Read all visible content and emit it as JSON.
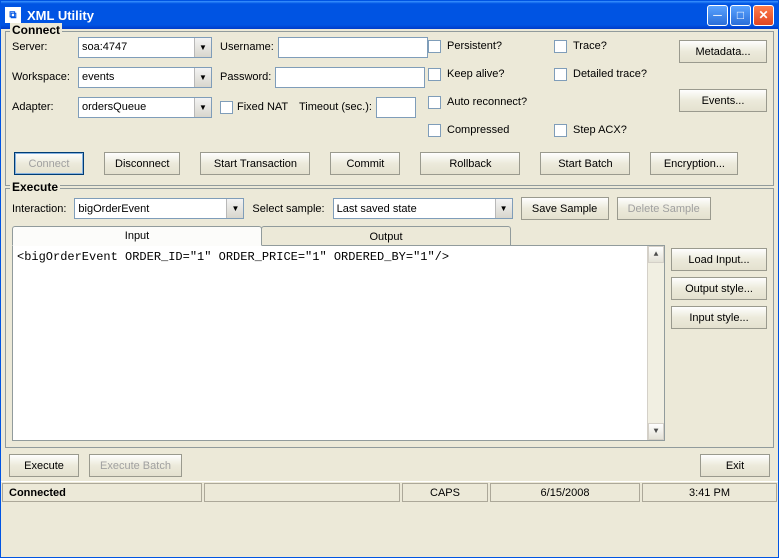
{
  "window": {
    "title": "XML Utility"
  },
  "connect": {
    "legend": "Connect",
    "server_label": "Server:",
    "server_value": "soa:4747",
    "workspace_label": "Workspace:",
    "workspace_value": "events",
    "adapter_label": "Adapter:",
    "adapter_value": "ordersQueue",
    "username_label": "Username:",
    "username_value": "",
    "password_label": "Password:",
    "password_value": "",
    "fixed_nat_label": "Fixed NAT",
    "timeout_label": "Timeout (sec.):",
    "timeout_value": "",
    "persistent_label": "Persistent?",
    "keepalive_label": "Keep alive?",
    "autoreconnect_label": "Auto reconnect?",
    "compressed_label": "Compressed",
    "trace_label": "Trace?",
    "detailed_trace_label": "Detailed trace?",
    "step_acx_label": "Step ACX?",
    "metadata_btn": "Metadata...",
    "events_btn": "Events...",
    "connect_btn": "Connect",
    "disconnect_btn": "Disconnect",
    "start_tx_btn": "Start Transaction",
    "commit_btn": "Commit",
    "rollback_btn": "Rollback",
    "start_batch_btn": "Start Batch",
    "encryption_btn": "Encryption..."
  },
  "execute": {
    "legend": "Execute",
    "interaction_label": "Interaction:",
    "interaction_value": "bigOrderEvent",
    "select_sample_label": "Select sample:",
    "select_sample_value": "Last saved state",
    "save_sample_btn": "Save Sample",
    "delete_sample_btn": "Delete Sample",
    "tab_input": "Input",
    "tab_output": "Output",
    "editor_text": "<bigOrderEvent ORDER_ID=\"1\" ORDER_PRICE=\"1\" ORDERED_BY=\"1\"/>",
    "load_input_btn": "Load Input...",
    "output_style_btn": "Output style...",
    "input_style_btn": "Input style...",
    "execute_btn": "Execute",
    "execute_batch_btn": "Execute Batch",
    "exit_btn": "Exit"
  },
  "status": {
    "connected": "Connected",
    "caps": "CAPS",
    "date": "6/15/2008",
    "time": "3:41 PM"
  }
}
